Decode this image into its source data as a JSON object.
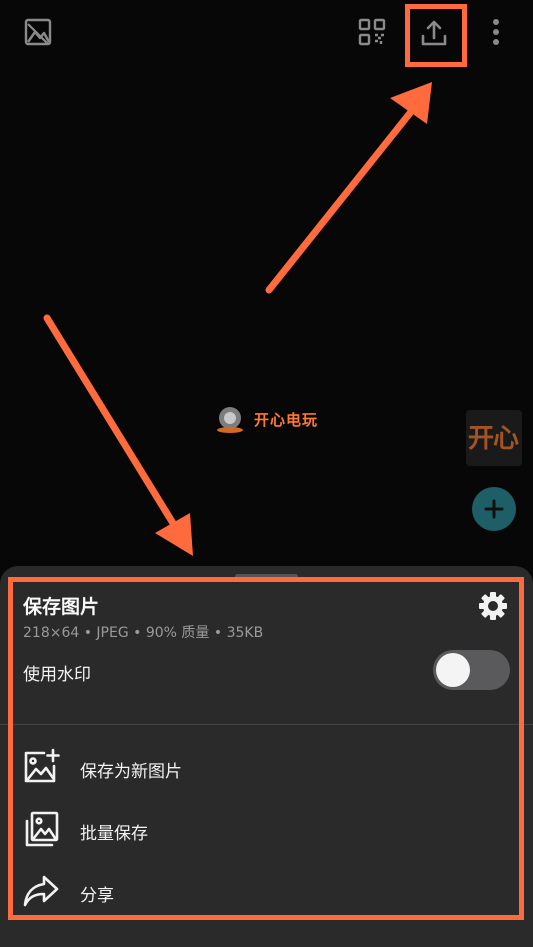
{
  "topbar": {
    "left_icon": "image-icon",
    "right_icons": [
      "qr-code-icon",
      "share-upload-icon",
      "more-vertical-icon"
    ]
  },
  "watermark": {
    "text": "开心电玩",
    "side_text": "开心"
  },
  "fab": {
    "icon": "plus-icon",
    "color": "#1e5e66"
  },
  "sheet": {
    "title": "保存图片",
    "subtitle": "218×64 • JPEG • 90% 质量 • 35KB",
    "settings_icon": "gear-icon",
    "watermark_label": "使用水印",
    "watermark_enabled": false,
    "actions": [
      {
        "label": "保存为新图片",
        "icon": "add-image-icon"
      },
      {
        "label": "批量保存",
        "icon": "images-icon"
      },
      {
        "label": "分享",
        "icon": "share-arrow-icon"
      }
    ]
  },
  "colors": {
    "annotation": "#ff6b3d",
    "background": "#070707",
    "sheet": "#2a2a2b"
  }
}
